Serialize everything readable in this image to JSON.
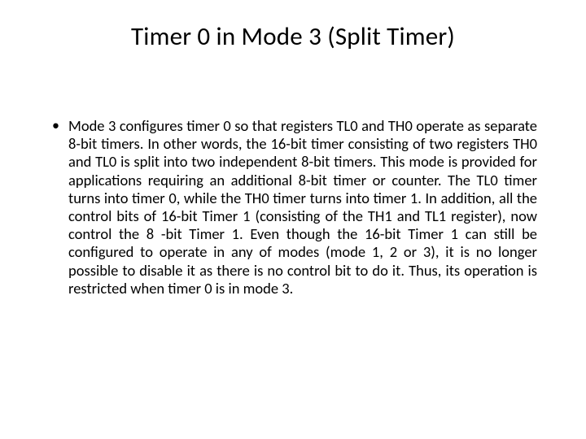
{
  "slide": {
    "title": "Timer 0 in Mode 3 (Split Timer)",
    "bullets": [
      "Mode 3 configures timer 0 so that registers TL0 and TH0 operate as separate 8-bit timers. In other words, the 16-bit timer consisting of two registers TH0 and TL0 is split into two independent 8-bit timers. This mode is provided for applications requiring an additional 8-bit timer or counter. The TL0 timer turns into timer 0, while the TH0 timer turns into timer 1. In addition, all the control bits of 16-bit Timer 1 (consisting of the TH1 and TL1 register), now control the 8 -bit Timer 1. Even though the 16-bit Timer 1 can still be configured to operate in any of modes (mode 1, 2 or 3), it is no longer possible to disable it as there is no control bit to do it. Thus, its operation is restricted when timer 0 is in mode 3."
    ]
  }
}
